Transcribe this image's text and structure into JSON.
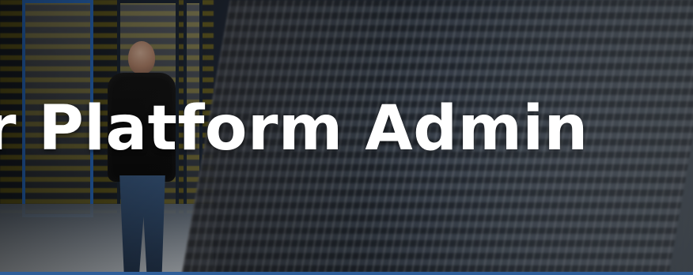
{
  "hero": {
    "title": "r Platform Admin",
    "accent_color": "#2f5f9a",
    "rack_accent_color": "#2b6fc6"
  }
}
